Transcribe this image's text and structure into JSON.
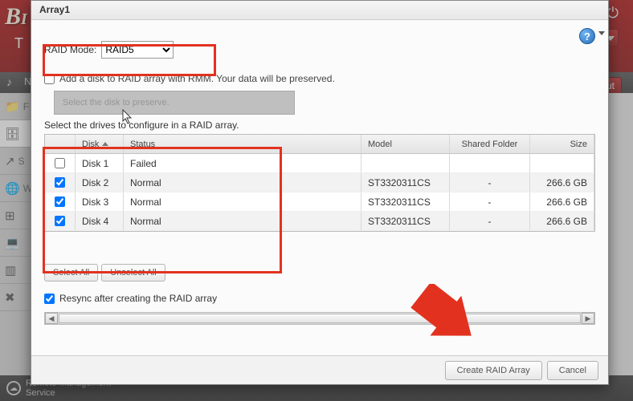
{
  "background": {
    "logo": "B",
    "sub": "T",
    "logout": "Log Out",
    "footer": "Remote Management\nService",
    "sidebar": [
      "F",
      "",
      "S",
      "W",
      "",
      "",
      "",
      ""
    ]
  },
  "dialog": {
    "title": "Array1",
    "raidMode": {
      "label": "RAID Mode:",
      "value": "RAID5"
    },
    "addDisk": {
      "label": "Add a disk to RAID array with RMM. Your data will be preserved.",
      "checked": false
    },
    "disabledSelect": "Select the disk to preserve.",
    "sectionHeader": "Select the drives to configure in a RAID array.",
    "columns": {
      "disk": "Disk",
      "status": "Status",
      "model": "Model",
      "shared": "Shared Folder",
      "size": "Size"
    },
    "rows": [
      {
        "checked": false,
        "disk": "Disk 1",
        "status": "Failed",
        "model": "",
        "shared": "",
        "size": ""
      },
      {
        "checked": true,
        "disk": "Disk 2",
        "status": "Normal",
        "model": "ST3320311CS",
        "shared": "-",
        "size": "266.6 GB"
      },
      {
        "checked": true,
        "disk": "Disk 3",
        "status": "Normal",
        "model": "ST3320311CS",
        "shared": "-",
        "size": "266.6 GB"
      },
      {
        "checked": true,
        "disk": "Disk 4",
        "status": "Normal",
        "model": "ST3320311CS",
        "shared": "-",
        "size": "266.6 GB"
      }
    ],
    "selectAll": "Select All",
    "unselectAll": "Unselect All",
    "resync": {
      "label": "Resync after creating the RAID array",
      "checked": true
    },
    "create": "Create RAID Array",
    "cancel": "Cancel"
  }
}
